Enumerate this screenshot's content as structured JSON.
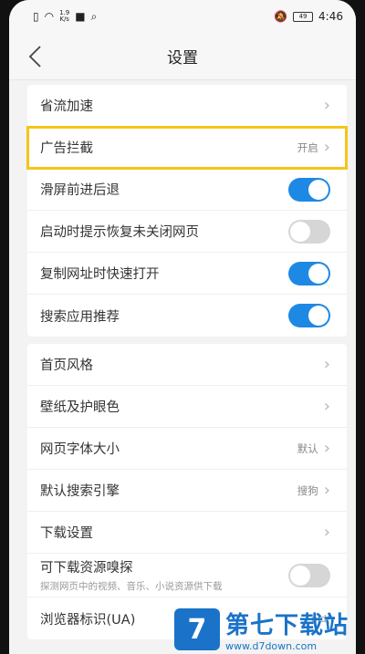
{
  "status": {
    "speed_top": "1.9",
    "speed_unit": "K/s",
    "time": "4:46",
    "battery": "49"
  },
  "header": {
    "title": "设置"
  },
  "groups": [
    {
      "rows": [
        {
          "label": "省流加速",
          "type": "link"
        },
        {
          "label": "广告拦截",
          "type": "link",
          "value": "开启",
          "highlighted": true
        },
        {
          "label": "滑屏前进后退",
          "type": "toggle",
          "on": true
        },
        {
          "label": "启动时提示恢复未关闭网页",
          "type": "toggle",
          "on": false
        },
        {
          "label": "复制网址时快速打开",
          "type": "toggle",
          "on": true
        },
        {
          "label": "搜索应用推荐",
          "type": "toggle",
          "on": true
        }
      ]
    },
    {
      "rows": [
        {
          "label": "首页风格",
          "type": "link"
        },
        {
          "label": "壁纸及护眼色",
          "type": "link"
        },
        {
          "label": "网页字体大小",
          "type": "link",
          "value": "默认"
        },
        {
          "label": "默认搜索引擎",
          "type": "link",
          "value": "搜狗"
        },
        {
          "label": "下载设置",
          "type": "link"
        },
        {
          "label": "可下载资源嗅探",
          "sub": "探测网页中的视频、音乐、小说资源供下载",
          "type": "toggle",
          "on": false
        },
        {
          "label": "浏览器标识(UA)",
          "type": "link",
          "value": "oid("
        }
      ]
    }
  ],
  "watermark": {
    "logo": "7",
    "title": "第七下载站",
    "url": "www.d7down.com"
  },
  "colors": {
    "accent": "#1e88e5",
    "highlight": "#f5c518"
  }
}
